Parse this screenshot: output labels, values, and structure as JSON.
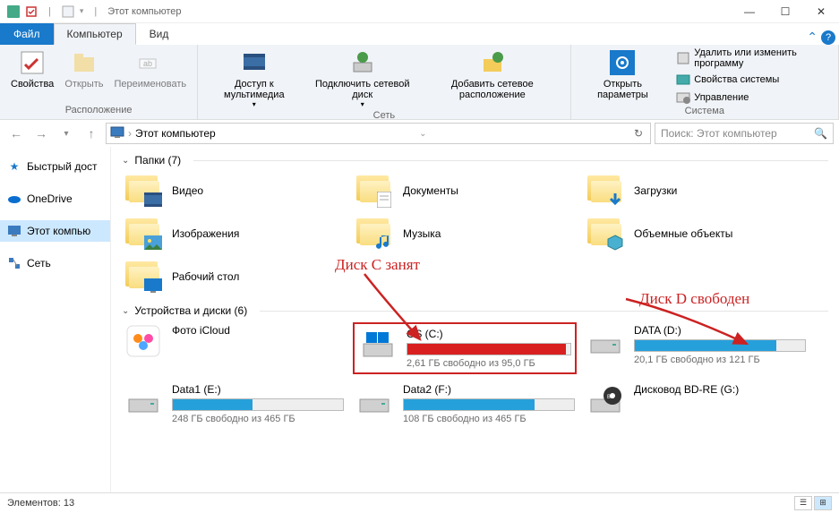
{
  "window": {
    "title": "Этот компьютер"
  },
  "tabs": {
    "file": "Файл",
    "computer": "Компьютер",
    "view": "Вид"
  },
  "ribbon": {
    "location_group": "Расположение",
    "network_group": "Сеть",
    "system_group": "Система",
    "props": "Свойства",
    "open": "Открыть",
    "rename": "Переименовать",
    "media": "Доступ к мультимедиа",
    "map_drive": "Подключить сетевой диск",
    "add_net": "Добавить сетевое расположение",
    "open_params": "Открыть параметры",
    "uninstall": "Удалить или изменить программу",
    "sys_props": "Свойства системы",
    "manage": "Управление"
  },
  "address": {
    "path": "Этот компьютер"
  },
  "search": {
    "placeholder": "Поиск: Этот компьютер"
  },
  "nav": {
    "quick": "Быстрый дост",
    "onedrive": "OneDrive",
    "thispc": "Этот компью",
    "network": "Сеть"
  },
  "groups": {
    "folders": "Папки (7)",
    "drives": "Устройства и диски (6)"
  },
  "folders": {
    "videos": "Видео",
    "documents": "Документы",
    "downloads": "Загрузки",
    "pictures": "Изображения",
    "music": "Музыка",
    "objects3d": "Объемные объекты",
    "desktop": "Рабочий стол"
  },
  "drives": {
    "icloud": {
      "name": "Фото iCloud"
    },
    "c": {
      "name": "OS (C:)",
      "free": "2,61 ГБ свободно из 95,0 ГБ",
      "pct": 97
    },
    "d": {
      "name": "DATA (D:)",
      "free": "20,1 ГБ свободно из 121 ГБ",
      "pct": 83
    },
    "e": {
      "name": "Data1 (E:)",
      "free": "248 ГБ свободно из 465 ГБ",
      "pct": 47
    },
    "f": {
      "name": "Data2 (F:)",
      "free": "108 ГБ свободно из 465 ГБ",
      "pct": 77
    },
    "g": {
      "name": "Дисковод BD-RE (G:)"
    }
  },
  "annotations": {
    "c_busy": "Диск С занят",
    "d_free": "Диск D свободен"
  },
  "status": {
    "items": "Элементов: 13"
  }
}
